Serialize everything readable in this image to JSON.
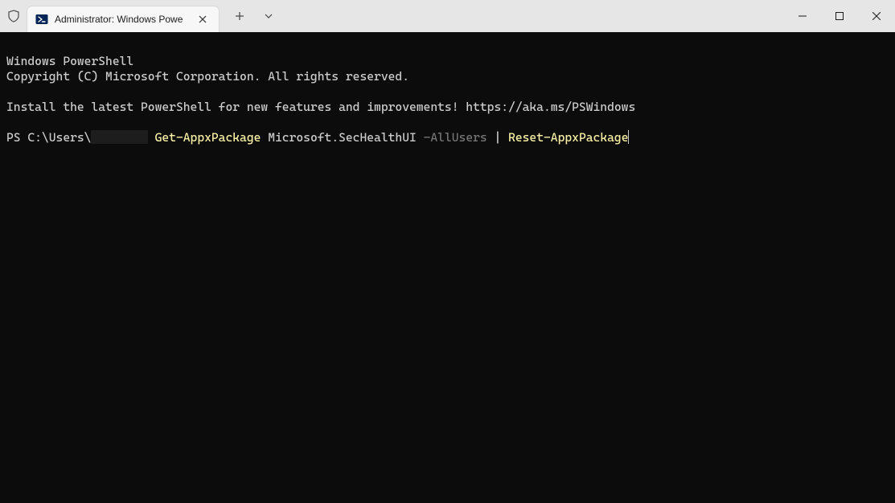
{
  "window": {
    "tab_title": "Administrator: Windows Powe",
    "icons": {
      "shield": "shield-icon",
      "ps": "powershell-icon",
      "close_tab": "close-icon",
      "new_tab": "plus-icon",
      "tab_menu": "chevron-down-icon",
      "minimize": "minimize-icon",
      "maximize": "maximize-icon",
      "close_window": "close-icon"
    }
  },
  "terminal": {
    "banner_line1": "Windows PowerShell",
    "banner_line2": "Copyright (C) Microsoft Corporation. All rights reserved.",
    "banner_line3": "Install the latest PowerShell for new features and improvements! https://aka.ms/PSWindows",
    "prompt_prefix": "PS C:\\Users\\",
    "prompt_suffix": " ",
    "cmd": {
      "p1": "Get-AppxPackage",
      "p2": " Microsoft.SecHealthUI ",
      "p3": "-AllUsers",
      "p4": " | ",
      "p5": "Reset-AppxPackage"
    }
  }
}
